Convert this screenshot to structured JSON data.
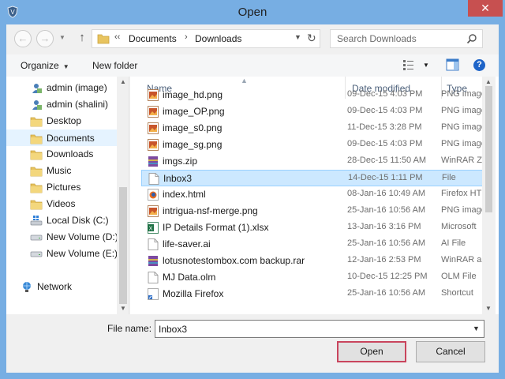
{
  "window": {
    "title": "Open",
    "close_glyph": "✕"
  },
  "address": {
    "back_glyph": "←",
    "forward_glyph": "→",
    "up_glyph": "↑",
    "overflow": "‹‹",
    "segments": [
      "Documents",
      "Downloads"
    ],
    "separator": "›",
    "dropdown_glyph": "▼",
    "refresh_glyph": "↻"
  },
  "search": {
    "placeholder": "Search Downloads"
  },
  "toolbar": {
    "organize_label": "Organize",
    "dropdown_glyph": "▼",
    "new_folder_label": "New folder",
    "help_glyph": "?"
  },
  "nav": {
    "items": [
      {
        "label": "admin (image)",
        "icon": "user-icon",
        "selected": false
      },
      {
        "label": "admin (shalini)",
        "icon": "user-icon",
        "selected": false
      },
      {
        "label": "Desktop",
        "icon": "folder-icon",
        "selected": false
      },
      {
        "label": "Documents",
        "icon": "folder-icon",
        "selected": true
      },
      {
        "label": "Downloads",
        "icon": "folder-icon",
        "selected": false
      },
      {
        "label": "Music",
        "icon": "folder-icon",
        "selected": false
      },
      {
        "label": "Pictures",
        "icon": "folder-icon",
        "selected": false
      },
      {
        "label": "Videos",
        "icon": "folder-icon",
        "selected": false
      },
      {
        "label": "Local Disk (C:)",
        "icon": "windows-drive-icon",
        "selected": false
      },
      {
        "label": "New Volume (D:)",
        "icon": "drive-icon",
        "selected": false
      },
      {
        "label": "New Volume (E:)",
        "icon": "drive-icon",
        "selected": false
      },
      {
        "label": "Network",
        "icon": "network-icon",
        "selected": false
      }
    ]
  },
  "files": {
    "columns": {
      "name": "Name",
      "date": "Date modified",
      "type": "Type"
    },
    "rows": [
      {
        "name": "image_hd.png",
        "date": "09-Dec-15 4:03 PM",
        "type": "PNG image",
        "icon": "image-file-icon",
        "selected": false
      },
      {
        "name": "image_OP.png",
        "date": "09-Dec-15 4:03 PM",
        "type": "PNG image",
        "icon": "image-file-icon",
        "selected": false
      },
      {
        "name": "image_s0.png",
        "date": "11-Dec-15 3:28 PM",
        "type": "PNG image",
        "icon": "image-file-icon",
        "selected": false
      },
      {
        "name": "image_sg.png",
        "date": "09-Dec-15 4:03 PM",
        "type": "PNG image",
        "icon": "image-file-icon",
        "selected": false
      },
      {
        "name": "imgs.zip",
        "date": "28-Dec-15 11:50 AM",
        "type": "WinRAR ZIP",
        "icon": "archive-file-icon",
        "selected": false
      },
      {
        "name": "Inbox3",
        "date": "14-Dec-15 1:11 PM",
        "type": "File",
        "icon": "blank-file-icon",
        "selected": true
      },
      {
        "name": "index.html",
        "date": "08-Jan-16 10:49 AM",
        "type": "Firefox HTML",
        "icon": "html-file-icon",
        "selected": false
      },
      {
        "name": "intrigua-nsf-merge.png",
        "date": "25-Jan-16 10:56 AM",
        "type": "PNG image",
        "icon": "image-file-icon",
        "selected": false
      },
      {
        "name": "IP Details Format (1).xlsx",
        "date": "13-Jan-16 3:16 PM",
        "type": "Microsoft",
        "icon": "excel-file-icon",
        "selected": false
      },
      {
        "name": "life-saver.ai",
        "date": "25-Jan-16 10:56 AM",
        "type": "AI File",
        "icon": "blank-file-icon",
        "selected": false
      },
      {
        "name": "lotusnotestombox.com backup.rar",
        "date": "12-Jan-16 2:53 PM",
        "type": "WinRAR arc",
        "icon": "archive-file-icon",
        "selected": false
      },
      {
        "name": "MJ Data.olm",
        "date": "10-Dec-15 12:25 PM",
        "type": "OLM File",
        "icon": "blank-file-icon",
        "selected": false
      },
      {
        "name": "Mozilla Firefox",
        "date": "25-Jan-16 10:56 AM",
        "type": "Shortcut",
        "icon": "shortcut-file-icon",
        "selected": false
      }
    ]
  },
  "footer": {
    "file_name_label": "File name:",
    "file_name_value": "Inbox3",
    "dropdown_glyph": "▼",
    "open_label": "Open",
    "cancel_label": "Cancel"
  },
  "colors": {
    "title_bar": "#77aee3",
    "close_button": "#c75050",
    "selection": "#cce8ff",
    "nav_selection": "#e5f3ff",
    "folder": "#e8c460",
    "open_border": "#c9455d"
  }
}
